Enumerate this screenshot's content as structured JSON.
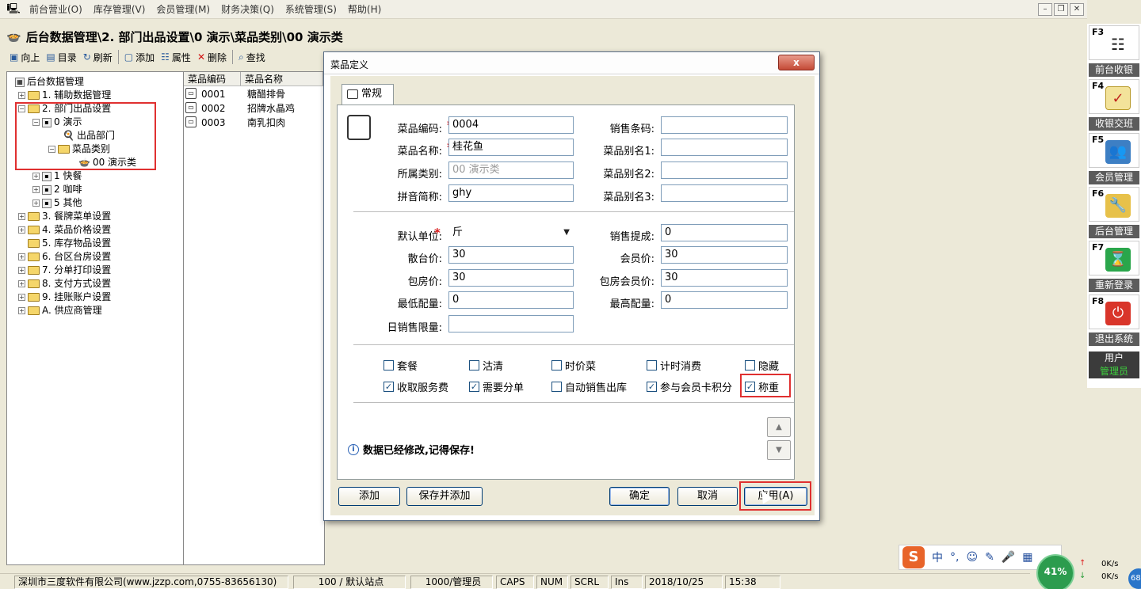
{
  "menubar": {
    "items": [
      "前台营业(O)",
      "库存管理(V)",
      "会员管理(M)",
      "财务决策(Q)",
      "系统管理(S)",
      "帮助(H)"
    ]
  },
  "pathbar": {
    "title": "后台数据管理\\2. 部门出品设置\\0 演示\\菜品类别\\00 演示类"
  },
  "toolbar": {
    "up": "向上",
    "dir": "目录",
    "refresh": "刷新",
    "add": "添加",
    "props": "属性",
    "delete": "删除",
    "find": "查找"
  },
  "tree": {
    "root": "后台数据管理",
    "n1": "1. 辅助数据管理",
    "n2": "2. 部门出品设置",
    "n2_0": "0 演示",
    "n2_0_a": "出品部门",
    "n2_0_b": "菜品类别",
    "n2_0_b_0": "00 演示类",
    "n2_1": "1 快餐",
    "n2_2": "2 咖啡",
    "n2_5": "5 其他",
    "n3": "3. 餐牌菜单设置",
    "n4": "4. 菜品价格设置",
    "n5": "5. 库存物品设置",
    "n6": "6. 台区台房设置",
    "n7": "7. 分单打印设置",
    "n8": "8. 支付方式设置",
    "n9": "9. 挂账账户设置",
    "nA": "A. 供应商管理"
  },
  "list": {
    "headers": [
      "菜品编码",
      "菜品名称"
    ],
    "rows": [
      {
        "code": "0001",
        "name": "糖醋排骨"
      },
      {
        "code": "0002",
        "name": "招牌水晶鸡"
      },
      {
        "code": "0003",
        "name": "南乳扣肉"
      }
    ]
  },
  "dialog": {
    "title": "菜品定义",
    "close": "x",
    "tab": "常规",
    "labels": {
      "code": "菜品编码:",
      "name": "菜品名称:",
      "category": "所属类别:",
      "pinyin": "拼音简称:",
      "barcode": "销售条码:",
      "alias1": "菜品别名1:",
      "alias2": "菜品别名2:",
      "alias3": "菜品别名3:",
      "unit": "默认单位:",
      "commission": "销售提成:",
      "hall_price": "散台价:",
      "member_price": "会员价:",
      "room_price": "包房价:",
      "room_member_price": "包房会员价:",
      "min_qty": "最低配量:",
      "max_qty": "最高配量:",
      "daily_limit": "日销售限量:"
    },
    "values": {
      "code": "0004",
      "name": "桂花鱼",
      "category": "00 演示类",
      "pinyin": "ghy",
      "barcode": "",
      "alias1": "",
      "alias2": "",
      "alias3": "",
      "unit": "斤",
      "commission": "0",
      "hall_price": "30",
      "member_price": "30",
      "room_price": "30",
      "room_member_price": "30",
      "min_qty": "0",
      "max_qty": "0",
      "daily_limit": ""
    },
    "star": "*",
    "checks": [
      {
        "label": "套餐",
        "checked": false
      },
      {
        "label": "沽清",
        "checked": false
      },
      {
        "label": "时价菜",
        "checked": false
      },
      {
        "label": "计时消费",
        "checked": false
      },
      {
        "label": "隐藏",
        "checked": false
      },
      {
        "label": "收取服务费",
        "checked": true
      },
      {
        "label": "需要分单",
        "checked": true
      },
      {
        "label": "自动销售出库",
        "checked": false
      },
      {
        "label": "参与会员卡积分",
        "checked": true
      },
      {
        "label": "称重",
        "checked": true
      }
    ],
    "note": "数据已经修改,记得保存!",
    "buttons": {
      "add": "添加",
      "save_add": "保存并添加",
      "ok": "确定",
      "cancel": "取消",
      "apply": "应用(A)"
    }
  },
  "sidebar": {
    "items": [
      {
        "key": "F3",
        "label": "前台收银"
      },
      {
        "key": "F4",
        "label": "收银交班"
      },
      {
        "key": "F5",
        "label": "会员管理"
      },
      {
        "key": "F6",
        "label": "后台管理"
      },
      {
        "key": "F7",
        "label": "重新登录"
      },
      {
        "key": "F8",
        "label": "退出系统"
      }
    ],
    "user_label": "用户",
    "user_name": "管理员"
  },
  "statusbar": {
    "company": "深圳市三度软件有限公司(www.jzzp.com,0755-83656130)",
    "site": "100 / 默认站点",
    "operator": "1000/管理员",
    "caps": "CAPS",
    "num": "NUM",
    "scrl": "SCRL",
    "ins": "Ins",
    "date": "2018/10/25",
    "time": "15:38"
  },
  "ime": {
    "logo": "S",
    "mode": "中"
  },
  "netwidget": {
    "percent": "41%",
    "up": "0K/s",
    "down": "0K/s",
    "badge": "68"
  },
  "colors": {
    "accent_red": "#e03030",
    "sidebar_label_bg": "#5c5c5c"
  }
}
